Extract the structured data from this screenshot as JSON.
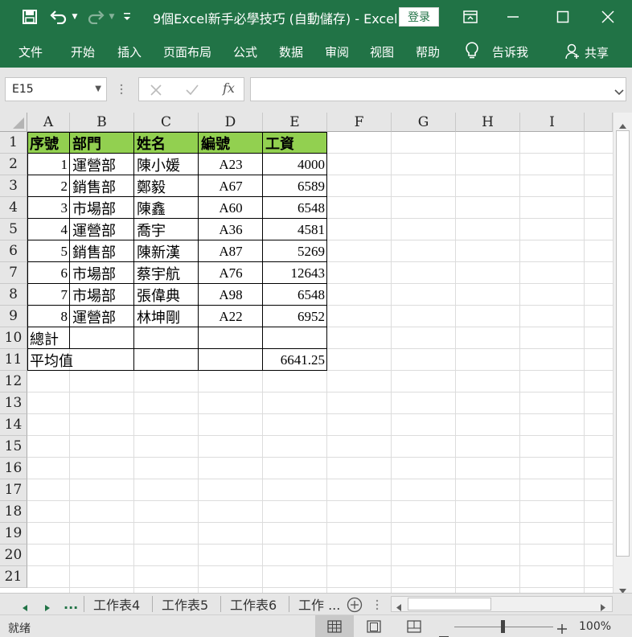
{
  "window": {
    "title": "9個Excel新手必學技巧 (自動儲存)  -  Excel",
    "login_label": "登录"
  },
  "ribbon": {
    "tabs": [
      "文件",
      "开始",
      "插入",
      "页面布局",
      "公式",
      "数据",
      "审阅",
      "视图",
      "帮助"
    ],
    "tell_me": "告诉我",
    "share": "共享"
  },
  "formula_bar": {
    "name_box": "E15",
    "fx_label": "fx",
    "formula": ""
  },
  "grid": {
    "columns": [
      "A",
      "B",
      "C",
      "D",
      "E",
      "F",
      "G",
      "H",
      "I"
    ],
    "rows": [
      "1",
      "2",
      "3",
      "4",
      "5",
      "6",
      "7",
      "8",
      "9",
      "10",
      "11",
      "12",
      "13",
      "14",
      "15",
      "16",
      "17",
      "18",
      "19",
      "20",
      "21"
    ],
    "header": [
      "序號",
      "部門",
      "姓名",
      "編號",
      "工資"
    ],
    "data": [
      [
        "1",
        "運營部",
        "陳小媛",
        "A23",
        "4000"
      ],
      [
        "2",
        "銷售部",
        "鄭毅",
        "A67",
        "6589"
      ],
      [
        "3",
        "市場部",
        "陳鑫",
        "A60",
        "6548"
      ],
      [
        "4",
        "運營部",
        "喬宇",
        "A36",
        "4581"
      ],
      [
        "5",
        "銷售部",
        "陳新漢",
        "A87",
        "5269"
      ],
      [
        "6",
        "市場部",
        "蔡宇航",
        "A76",
        "12643"
      ],
      [
        "7",
        "市場部",
        "張偉典",
        "A98",
        "6548"
      ],
      [
        "8",
        "運營部",
        "林坤剛",
        "A22",
        "6952"
      ]
    ],
    "total_label": "總計",
    "avg_label": "平均值",
    "avg_value": "6641.25"
  },
  "sheets": {
    "more_left": "...",
    "tabs": [
      "工作表4",
      "工作表5",
      "工作表6",
      "工作 ..."
    ]
  },
  "status": {
    "ready": "就绪",
    "zoom": "100%"
  },
  "colors": {
    "brand": "#217346",
    "header_fill": "#92d050"
  }
}
